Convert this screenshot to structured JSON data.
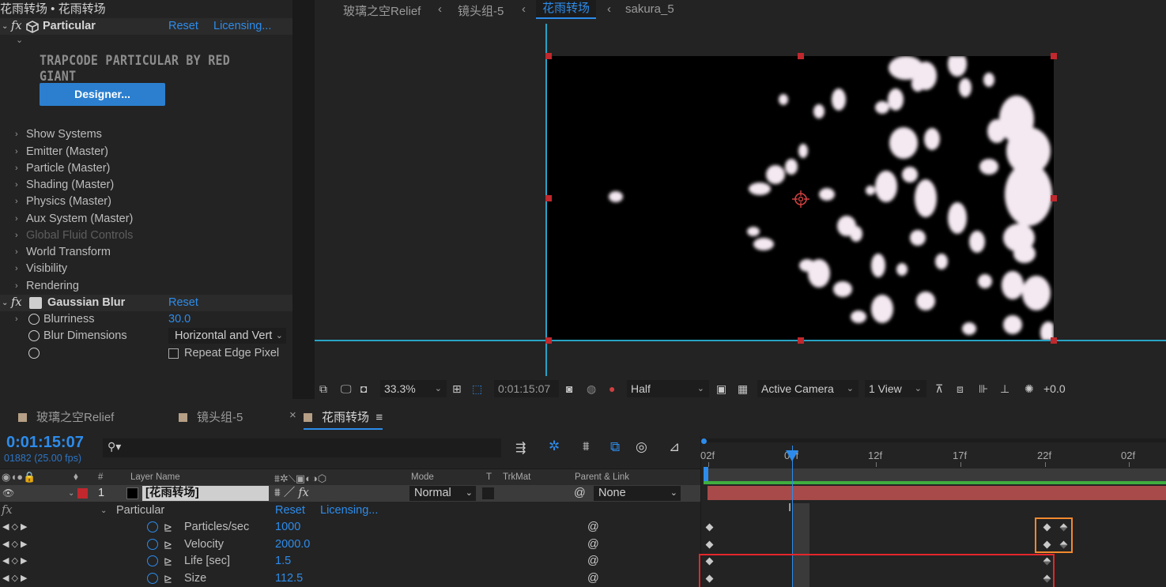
{
  "effects_panel": {
    "title": "花雨转场 • 花雨转场",
    "particular": {
      "name": "Particular",
      "reset": "Reset",
      "licensing": "Licensing...",
      "banner": "TRAPCODE PARTICULAR BY RED GIANT",
      "designer_button": "Designer...",
      "groups": [
        "Show Systems",
        "Emitter (Master)",
        "Particle (Master)",
        "Shading (Master)",
        "Physics (Master)",
        "Aux System (Master)",
        "Global Fluid Controls",
        "World Transform",
        "Visibility",
        "Rendering"
      ]
    },
    "gaussian_blur": {
      "name": "Gaussian Blur",
      "reset": "Reset",
      "blurriness_label": "Blurriness",
      "blurriness_value": "30.0",
      "dimensions_label": "Blur Dimensions",
      "dimensions_value": "Horizontal and Vert",
      "repeat_edge_label": "Repeat Edge Pixel"
    }
  },
  "viewer": {
    "breadcrumbs": [
      "玻璃之空Relief",
      "镜头组-5",
      "花雨转场",
      "sakura_5"
    ],
    "active_crumb": "花雨转场",
    "toolbar": {
      "zoom": "33.3%",
      "timecode": "0:01:15:07",
      "resolution": "Half",
      "camera": "Active Camera",
      "views": "1 View",
      "exposure": "+0.0"
    }
  },
  "timeline": {
    "tabs": [
      "玻璃之空Relief",
      "镜头组-5",
      "花雨转场"
    ],
    "active_tab": "花雨转场",
    "current_time": "0:01:15:07",
    "frame_info": "01882 (25.00 fps)",
    "search_placeholder": "",
    "columns": {
      "num": "#",
      "layer_name": "Layer Name",
      "mode": "Mode",
      "t": "T",
      "trkmat": "TrkMat",
      "parent": "Parent & Link"
    },
    "ruler": [
      "02f",
      "07f",
      "12f",
      "17f",
      "22f",
      "02f"
    ],
    "layer": {
      "index": "1",
      "name": "[花雨转场]",
      "mode": "Normal",
      "parent": "None"
    },
    "effect": {
      "fx": "fx",
      "name": "Particular",
      "reset": "Reset",
      "licensing": "Licensing..."
    },
    "properties": [
      {
        "name": "Particles/sec",
        "value": "1000"
      },
      {
        "name": "Velocity",
        "value": "2000.0"
      },
      {
        "name": "Life [sec]",
        "value": "1.5"
      },
      {
        "name": "Size",
        "value": "112.5"
      }
    ]
  },
  "colors": {
    "accent": "#2d8ceb",
    "guide": "#27a3c4",
    "handle": "#c0282d",
    "highlight_orange": "#f28a2e",
    "highlight_red": "#e5262b",
    "layer_bar": "#a84a4a"
  }
}
